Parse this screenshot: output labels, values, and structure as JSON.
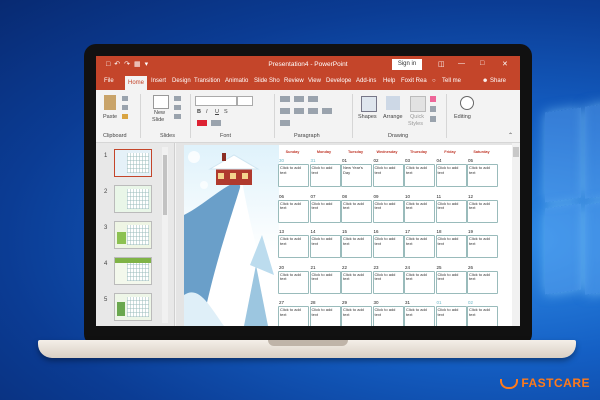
{
  "app": {
    "window_title": "Presentation4 - PowerPoint",
    "sign_in": "Sign in",
    "tabs": [
      "File",
      "Home",
      "Insert",
      "Design",
      "Transition",
      "Animatio",
      "Slide Sho",
      "Review",
      "View",
      "Develope",
      "Add-ins",
      "Help",
      "Foxit Rea"
    ],
    "tell_me": "Tell me",
    "share": "Share"
  },
  "ribbon": {
    "paste": "Paste",
    "clipboard": "Clipboard",
    "new_slide_1": "New",
    "new_slide_2": "Slide",
    "slides": "Slides",
    "font": "Font",
    "paragraph": "Paragraph",
    "shapes": "Shapes",
    "arrange": "Arrange",
    "quick_styles_1": "Quick",
    "quick_styles_2": "Styles",
    "drawing": "Drawing",
    "editing": "Editing",
    "bold": "B",
    "italic": "I",
    "underline": "U",
    "strike": "S"
  },
  "thumbnails": [
    "1",
    "2",
    "3",
    "4",
    "5"
  ],
  "calendar": {
    "days": [
      "Sunday",
      "Monday",
      "Tuesday",
      "Wednesday",
      "Thursday",
      "Friday",
      "Saturday"
    ],
    "placeholder": "Click to add text",
    "rows": [
      [
        {
          "n": "30",
          "o": true
        },
        {
          "n": "31",
          "o": true
        },
        {
          "n": "01",
          "t": "New Year's Day"
        },
        {
          "n": "02"
        },
        {
          "n": "03"
        },
        {
          "n": "04"
        },
        {
          "n": "05"
        }
      ],
      [
        {
          "n": "06"
        },
        {
          "n": "07"
        },
        {
          "n": "08"
        },
        {
          "n": "09"
        },
        {
          "n": "10"
        },
        {
          "n": "11"
        },
        {
          "n": "12"
        }
      ],
      [
        {
          "n": "13"
        },
        {
          "n": "14"
        },
        {
          "n": "15"
        },
        {
          "n": "16"
        },
        {
          "n": "17"
        },
        {
          "n": "18"
        },
        {
          "n": "19"
        }
      ],
      [
        {
          "n": "20"
        },
        {
          "n": "21"
        },
        {
          "n": "22"
        },
        {
          "n": "23"
        },
        {
          "n": "24"
        },
        {
          "n": "25"
        },
        {
          "n": "26"
        }
      ],
      [
        {
          "n": "27"
        },
        {
          "n": "28"
        },
        {
          "n": "29"
        },
        {
          "n": "30"
        },
        {
          "n": "31"
        },
        {
          "n": "01",
          "o": true
        },
        {
          "n": "02",
          "o": true
        }
      ]
    ]
  },
  "brand": "FASTCARE",
  "colors": {
    "accent": "#c4452a",
    "title_red": "#c0392b",
    "background": "#145fc4",
    "fastcare": "#ff7a1a"
  }
}
